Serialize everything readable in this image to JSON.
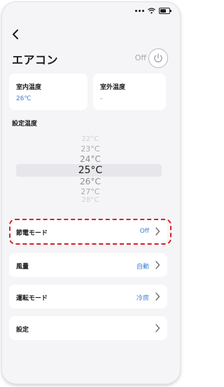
{
  "header": {
    "title": "エアコン",
    "power_state": "Off"
  },
  "indoor": {
    "label": "室内温度",
    "value": "26℃"
  },
  "outdoor": {
    "label": "室外温度",
    "value": "-"
  },
  "setpoint": {
    "label": "設定温度",
    "options": [
      "22°C",
      "23°C",
      "24°C",
      "25°C",
      "26°C",
      "27°C",
      "28°C"
    ],
    "selected": "25°C"
  },
  "rows": [
    {
      "label": "節電モード",
      "value": "Off"
    },
    {
      "label": "風量",
      "value": "自動"
    },
    {
      "label": "運転モード",
      "value": "冷房"
    },
    {
      "label": "設定",
      "value": ""
    }
  ],
  "colors": {
    "accent": "#3a7bd5",
    "highlight": "#d2232a",
    "background": "#f5f5f7"
  }
}
